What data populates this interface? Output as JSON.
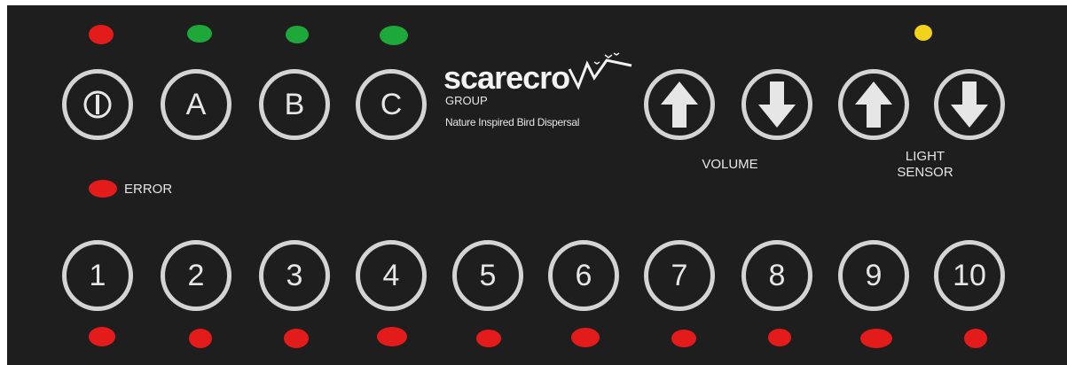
{
  "top_buttons": [
    {
      "id": "power",
      "label": "",
      "icon": "power-icon"
    },
    {
      "id": "a",
      "label": "A"
    },
    {
      "id": "b",
      "label": "B"
    },
    {
      "id": "c",
      "label": "C"
    }
  ],
  "status_leds": [
    "#e31b1b",
    "#1fa83a",
    "#1fa83a",
    "#1fa83a"
  ],
  "logo": {
    "word": "scarecro",
    "group": "GROUP",
    "tagline": "Nature Inspired Bird Dispersal"
  },
  "volume": {
    "label": "VOLUME",
    "up_icon": "arrow-up-icon",
    "down_icon": "arrow-down-icon"
  },
  "light_sensor": {
    "label_line1": "LIGHT",
    "label_line2": "SENSOR",
    "indicator_color": "#f2d31a"
  },
  "error": {
    "label": "ERROR",
    "color": "#e31b1b"
  },
  "number_buttons": [
    "1",
    "2",
    "3",
    "4",
    "5",
    "6",
    "7",
    "8",
    "9",
    "10"
  ],
  "channel_led_color": "#e31b1b"
}
